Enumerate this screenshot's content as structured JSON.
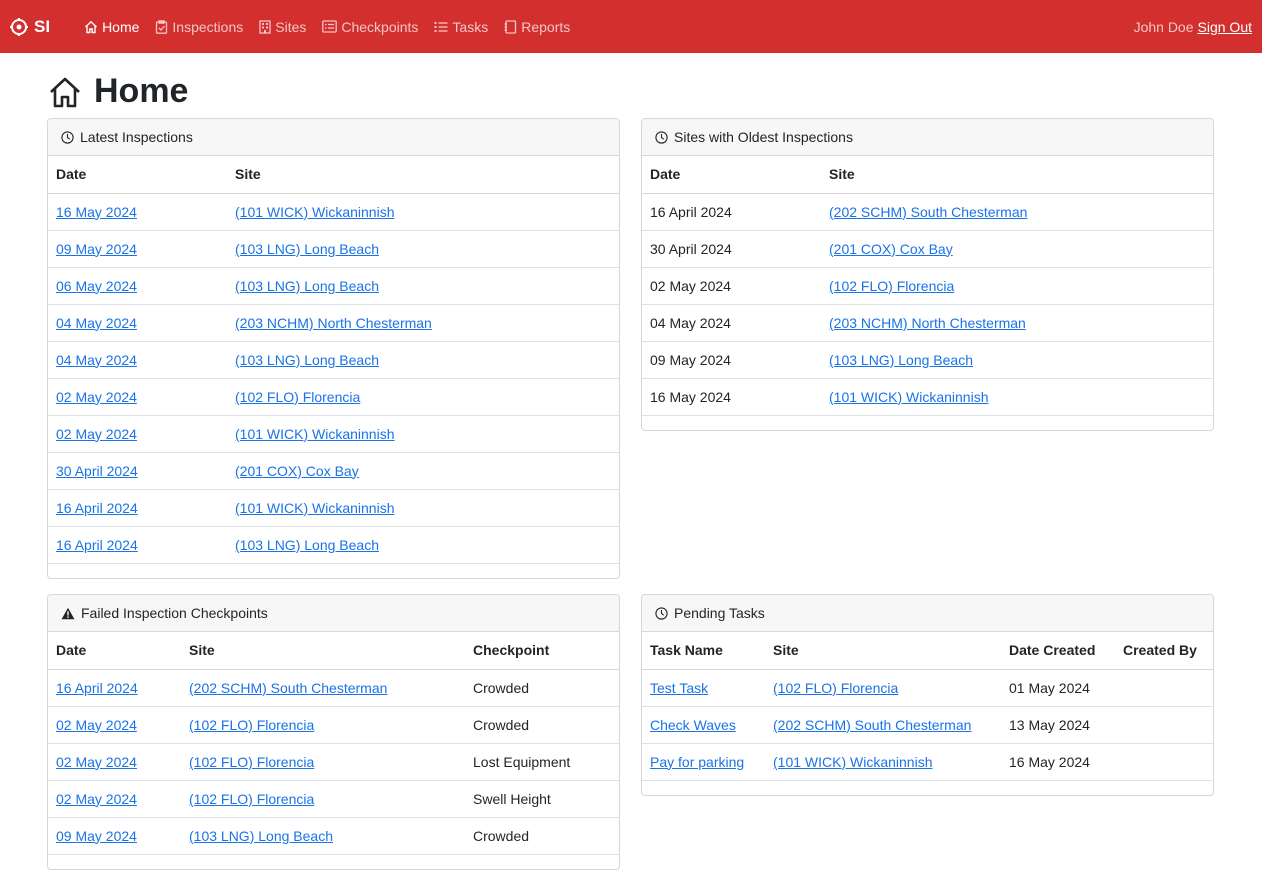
{
  "nav": {
    "brand": "SI",
    "items": [
      {
        "label": "Home",
        "icon": "house-icon",
        "active": true
      },
      {
        "label": "Inspections",
        "icon": "clipboard-check-icon"
      },
      {
        "label": "Sites",
        "icon": "building-icon"
      },
      {
        "label": "Checkpoints",
        "icon": "card-list-icon"
      },
      {
        "label": "Tasks",
        "icon": "list-task-icon"
      },
      {
        "label": "Reports",
        "icon": "journal-icon"
      }
    ],
    "user": "John Doe",
    "signout": "Sign Out",
    "color": "#d32f2f"
  },
  "page": {
    "title": "Home"
  },
  "latest": {
    "title": "Latest Inspections",
    "headers": [
      "Date",
      "Site"
    ],
    "rows": [
      [
        "16 May 2024",
        "(101 WICK) Wickaninnish"
      ],
      [
        "09 May 2024",
        "(103 LNG) Long Beach"
      ],
      [
        "06 May 2024",
        "(103 LNG) Long Beach"
      ],
      [
        "04 May 2024",
        "(203 NCHM) North Chesterman"
      ],
      [
        "04 May 2024",
        "(103 LNG) Long Beach"
      ],
      [
        "02 May 2024",
        "(102 FLO) Florencia"
      ],
      [
        "02 May 2024",
        "(101 WICK) Wickaninnish"
      ],
      [
        "30 April 2024",
        "(201 COX) Cox Bay"
      ],
      [
        "16 April 2024",
        "(101 WICK) Wickaninnish"
      ],
      [
        "16 April 2024",
        "(103 LNG) Long Beach"
      ]
    ]
  },
  "oldest": {
    "title": "Sites with Oldest Inspections",
    "headers": [
      "Date",
      "Site"
    ],
    "rows": [
      [
        "16 April 2024",
        "(202 SCHM) South Chesterman"
      ],
      [
        "30 April 2024",
        "(201 COX) Cox Bay"
      ],
      [
        "02 May 2024",
        "(102 FLO) Florencia"
      ],
      [
        "04 May 2024",
        "(203 NCHM) North Chesterman"
      ],
      [
        "09 May 2024",
        "(103 LNG) Long Beach"
      ],
      [
        "16 May 2024",
        "(101 WICK) Wickaninnish"
      ]
    ]
  },
  "failed": {
    "title": "Failed Inspection Checkpoints",
    "headers": [
      "Date",
      "Site",
      "Checkpoint"
    ],
    "rows": [
      [
        "16 April 2024",
        "(202 SCHM) South Chesterman",
        "Crowded"
      ],
      [
        "02 May 2024",
        "(102 FLO) Florencia",
        "Crowded"
      ],
      [
        "02 May 2024",
        "(102 FLO) Florencia",
        "Lost Equipment"
      ],
      [
        "02 May 2024",
        "(102 FLO) Florencia",
        "Swell Height"
      ],
      [
        "09 May 2024",
        "(103 LNG) Long Beach",
        "Crowded"
      ]
    ]
  },
  "tasks": {
    "title": "Pending Tasks",
    "headers": [
      "Task Name",
      "Site",
      "Date Created",
      "Created By"
    ],
    "rows": [
      [
        "Test Task",
        "(102 FLO) Florencia",
        "01 May 2024",
        ""
      ],
      [
        "Check Waves",
        "(202 SCHM) South Chesterman",
        "13 May 2024",
        ""
      ],
      [
        "Pay for parking",
        "(101 WICK) Wickaninnish",
        "16 May 2024",
        ""
      ]
    ]
  }
}
